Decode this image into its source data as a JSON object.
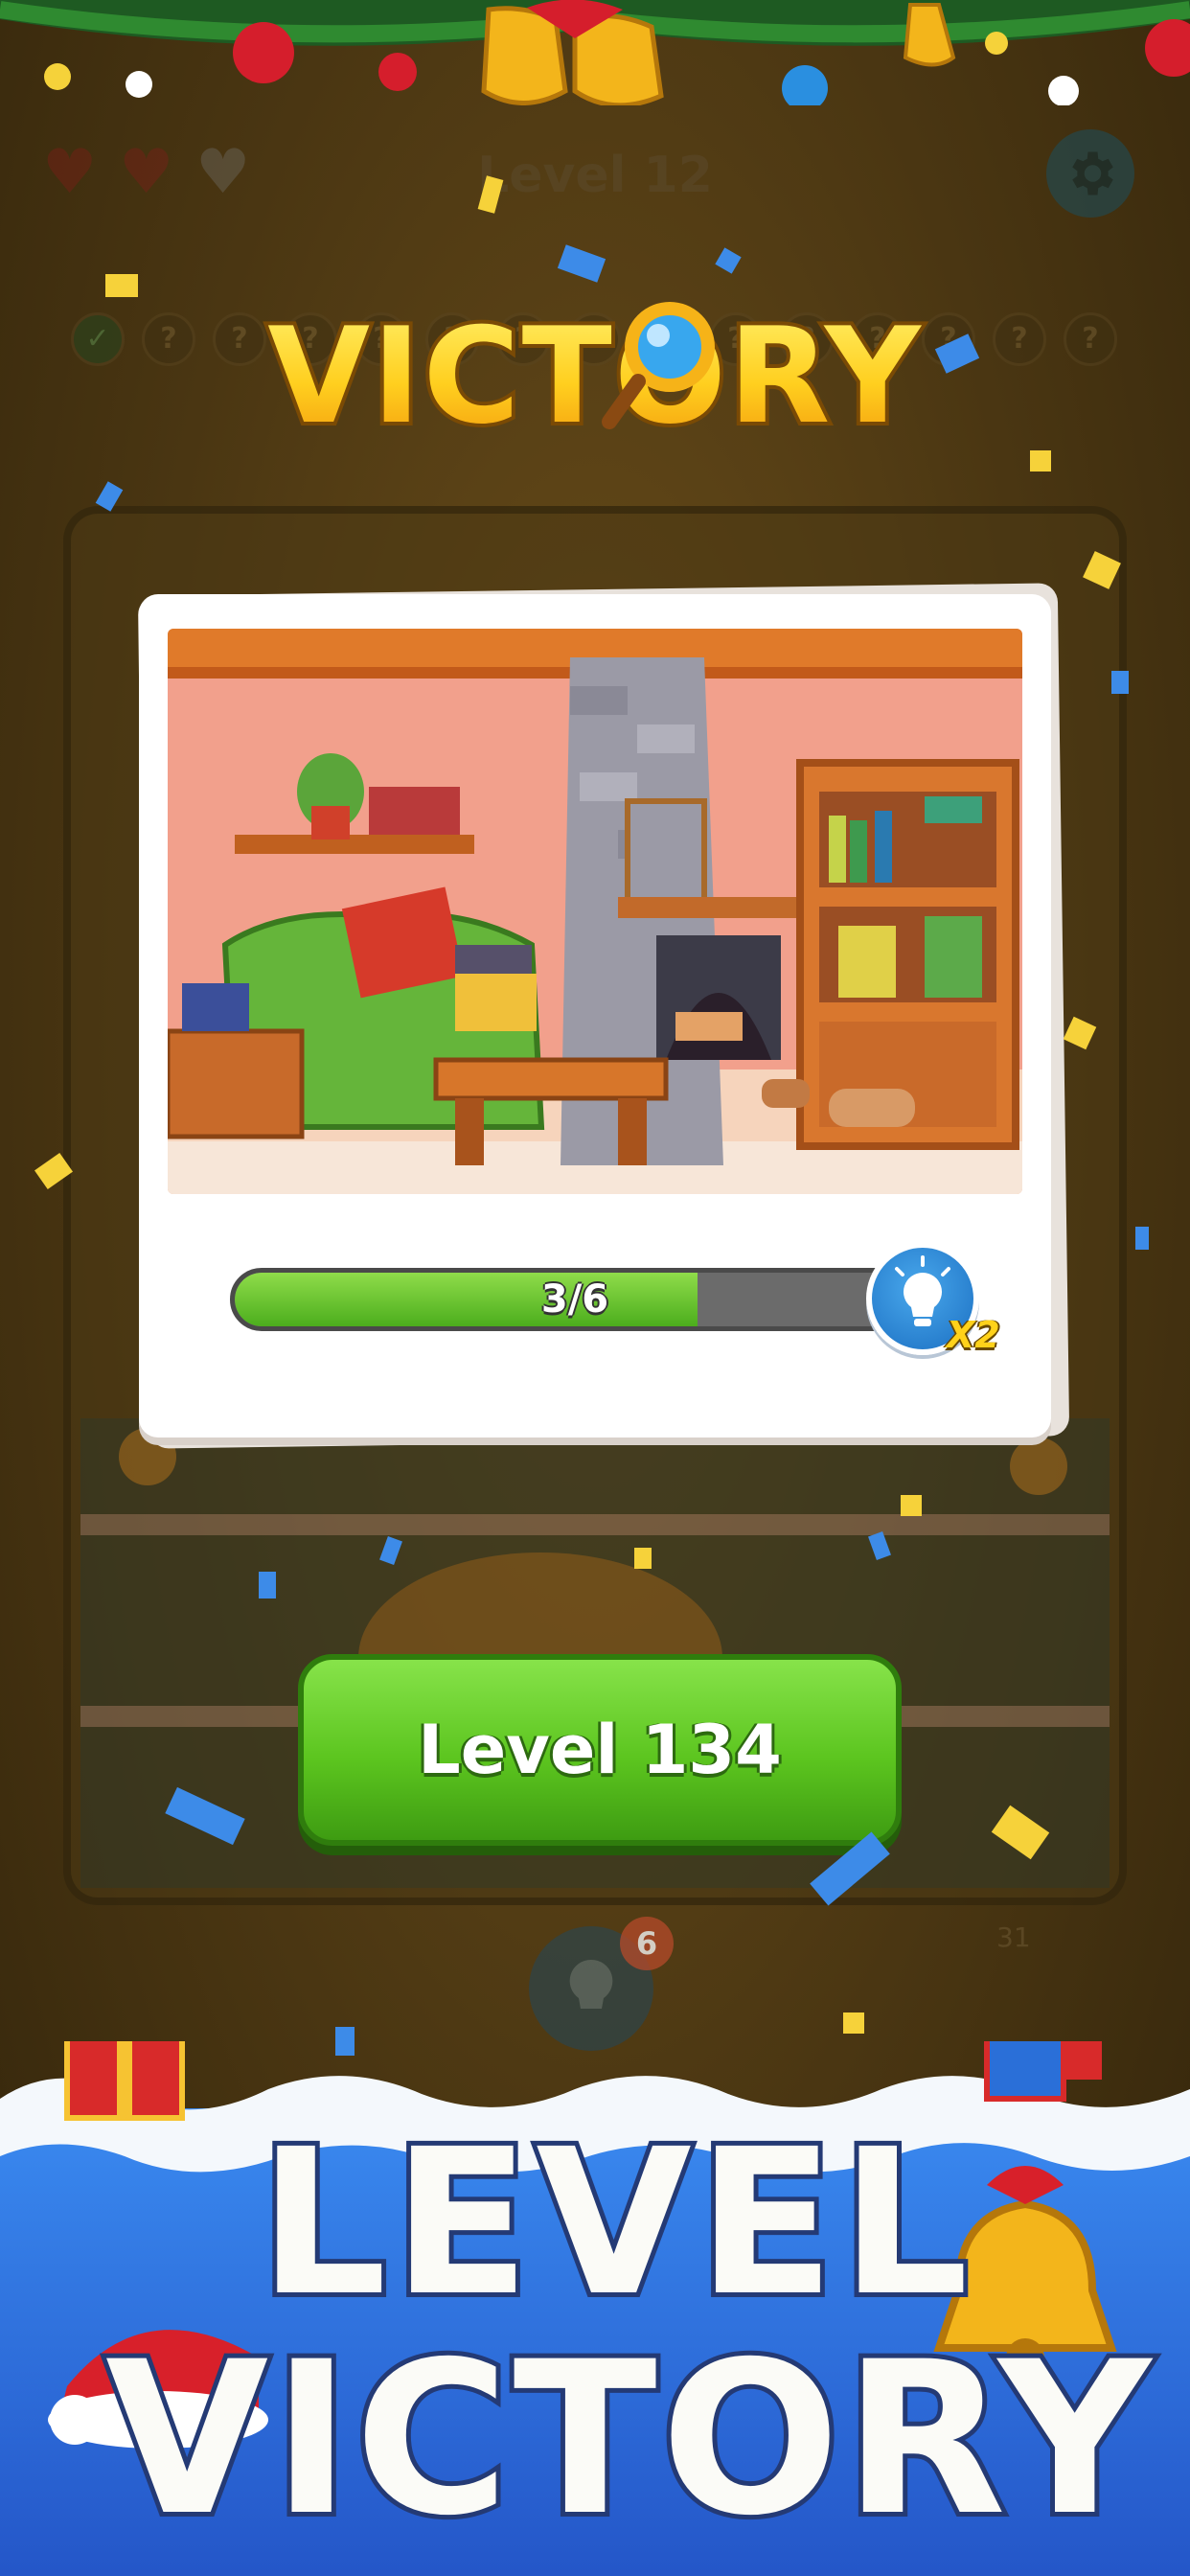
{
  "header": {
    "level_label": "Level 12",
    "hearts": [
      "full",
      "full",
      "empty"
    ],
    "settings_icon": "gear-icon"
  },
  "progress_dots": [
    "done",
    "?",
    "?",
    "?",
    "?",
    "?",
    "?",
    "?",
    "?",
    "?",
    "?",
    "?",
    "?",
    "?",
    "?"
  ],
  "victory": {
    "title": "VICTORY"
  },
  "card": {
    "scene": "cozy-living-room-illustration",
    "progress": {
      "text": "3/6",
      "found": 3,
      "total": 6
    },
    "hint": {
      "icon": "lightbulb-icon",
      "multiplier": "X2"
    }
  },
  "next_button": {
    "label": "Level 134"
  },
  "bottom_hint": {
    "badge": "6",
    "score": "31"
  },
  "banner": {
    "line1": "LEVEL",
    "line2": "VICTORY"
  },
  "colors": {
    "background": "#4a3612",
    "button_green": "#5cc51f",
    "banner_blue": "#2f6fe0",
    "title_gold": "#ffcf1f"
  }
}
